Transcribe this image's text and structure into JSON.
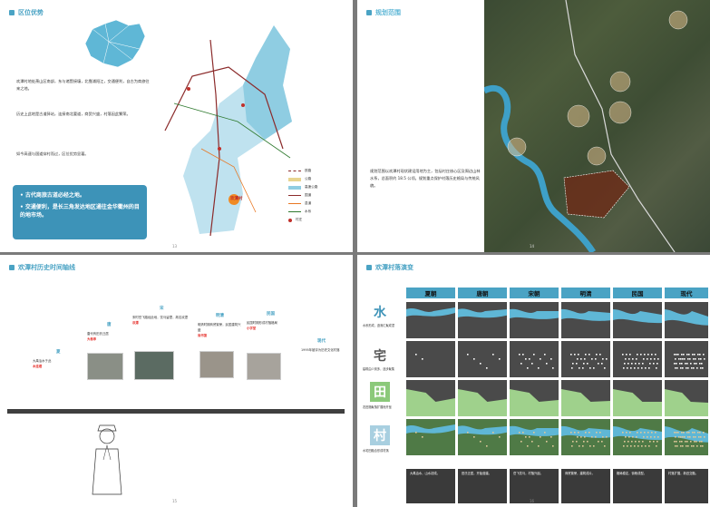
{
  "p1": {
    "title": "区位优势",
    "paragraphs": [
      "欢潭村地处萧山区南部，东与诸暨接壤，北靠浦阳江，交通便利，自古为商旅往来之地。",
      "历史上此地是古道驿站，连接南北要道，商贸兴盛，村落因此繁荣。",
      "如今高速与国道穿村而过，区位优势显著。"
    ],
    "callout": [
      "• 古代商旅古道必经之地。",
      "• 交通便利，是长三角发达地区通往金华衢州的目的地市场。"
    ],
    "legend": [
      "铁路",
      "公路",
      "高速公路",
      "国道",
      "县道",
      "水系",
      "村庄"
    ],
    "map_labels": {
      "village": "欢潭村"
    },
    "page_number": "13"
  },
  "p2": {
    "title": "规划范围",
    "text": "规划范围以欢潭村现状建设用地为主，包括村庄核心区及周边山林水系，总面积约 18.5 公顷。规划重点保护村落历史格局与传统风貌。",
    "page_number": "14"
  },
  "p3": {
    "title": "欢潭村历史时间轴线",
    "eras": [
      {
        "name": "夏",
        "desc": "大禹治水于此",
        "hi": "木连理"
      },
      {
        "name": "唐",
        "desc": "唐代有田氏迁居",
        "hi": "大巷亭"
      },
      {
        "name": "宋",
        "desc": "宋时岳飞路经此地，饮马留潭，故名欢潭",
        "hi": "欢潭"
      },
      {
        "name": "明清",
        "desc": "明清时期商贸繁荣，民居建筑兴盛",
        "hi": "尚书第"
      },
      {
        "name": "民国",
        "desc": "民国时期形成村落格局",
        "hi": "小学堂"
      },
      {
        "name": "现代",
        "desc": "1995年被评为历史文化村落",
        "hi": ""
      }
    ],
    "page_number": "15"
  },
  "p4": {
    "title": "欢潭村落演变",
    "columns": [
      "夏朝",
      "唐朝",
      "宋朝",
      "明清",
      "民国",
      "现代"
    ],
    "rows": [
      {
        "label": "水",
        "desc": "水系形成，逐渐汇聚成潭"
      },
      {
        "label": "宅",
        "desc": "建筑由少到多，逐步聚集"
      },
      {
        "label": "田",
        "desc": "农田随聚落扩展而开垦"
      },
      {
        "label": "村",
        "desc": "水宅田融合形成村落"
      }
    ],
    "footer": [
      "大禹治水，山水初成。",
      "田氏迁居，开始营建。",
      "岳飞饮马，村落兴起。",
      "商贸繁荣，建筑成片。",
      "格局稳定，街巷成型。",
      "村落扩展，新旧交融。"
    ],
    "page_number": "16"
  }
}
